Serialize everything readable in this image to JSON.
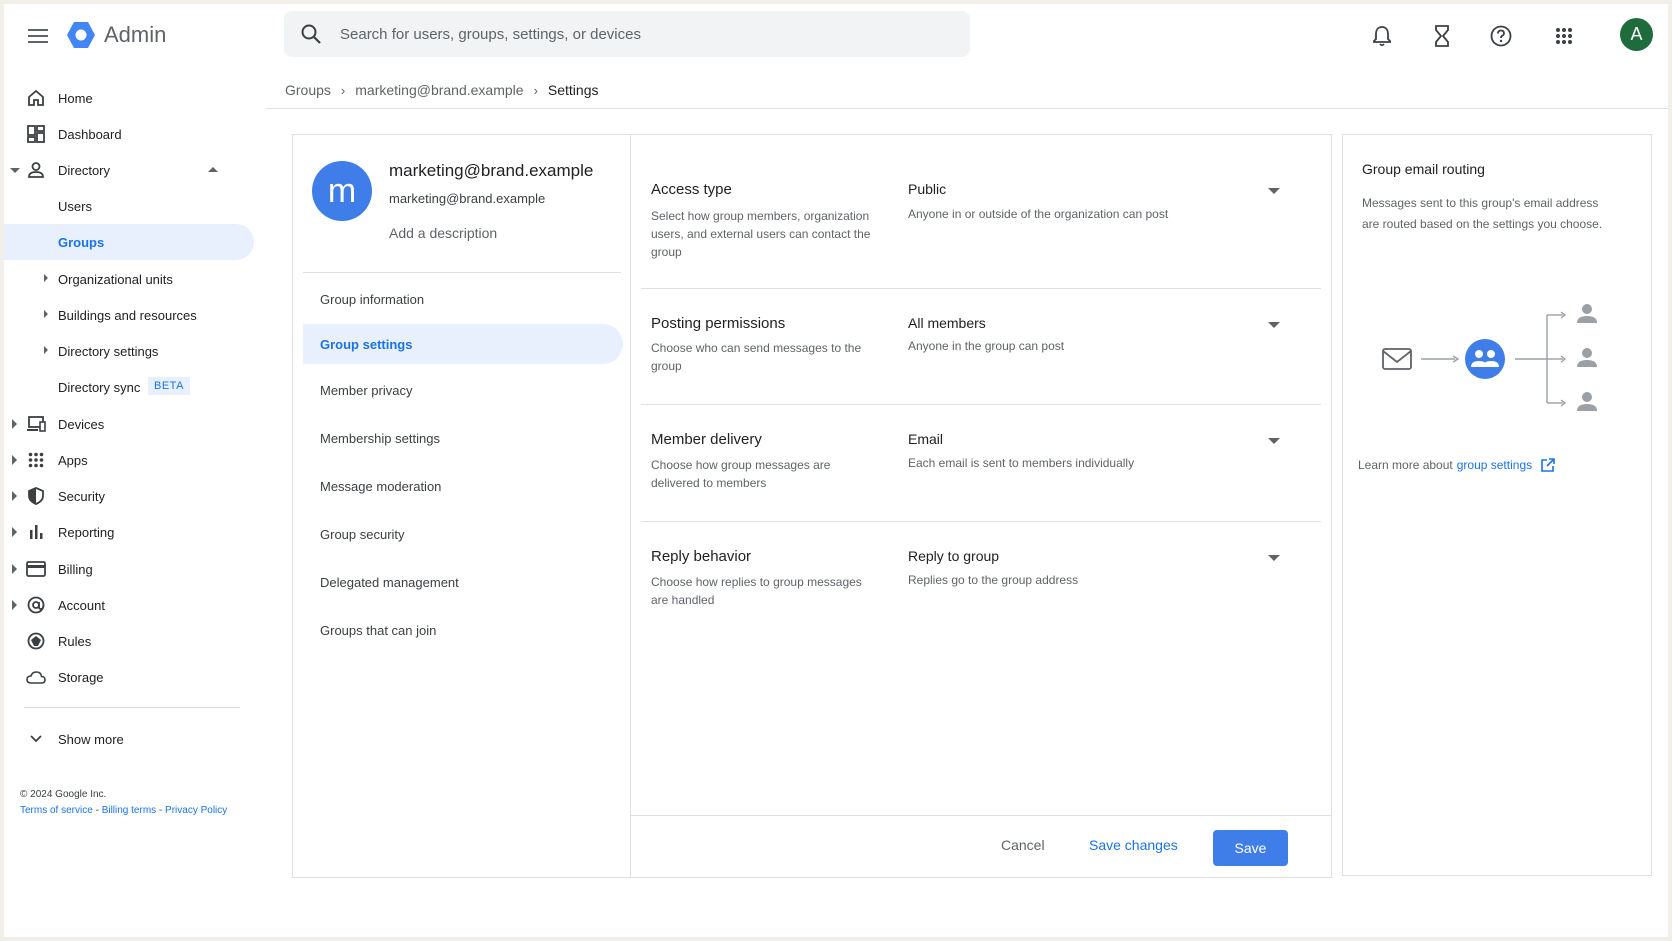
{
  "app": {
    "title": "Admin"
  },
  "search": {
    "placeholder": "Search for users, groups, settings, or devices"
  },
  "user": {
    "initial": "A"
  },
  "sidebar": {
    "items": [
      {
        "label": "Home"
      },
      {
        "label": "Dashboard"
      },
      {
        "label": "Directory"
      },
      {
        "label": "Users"
      },
      {
        "label": "Groups"
      },
      {
        "label": "Organizational units"
      },
      {
        "label": "Buildings and resources"
      },
      {
        "label": "Directory settings"
      },
      {
        "label": "Directory sync"
      },
      {
        "label": "Devices"
      },
      {
        "label": "Apps"
      },
      {
        "label": "Security"
      },
      {
        "label": "Reporting"
      },
      {
        "label": "Billing"
      },
      {
        "label": "Account"
      },
      {
        "label": "Rules"
      },
      {
        "label": "Storage"
      }
    ],
    "beta_badge": "BETA",
    "show_more": "Show more"
  },
  "footer": {
    "copyright": "© 2024 Google Inc.",
    "terms": "Terms of service",
    "billing_terms": "Billing terms",
    "privacy": "Privacy Policy",
    "separator": " - "
  },
  "breadcrumb": {
    "items": [
      "Groups",
      "marketing@brand.example",
      "Settings"
    ]
  },
  "group": {
    "avatar_letter": "m",
    "title": "marketing@brand.example",
    "email": "marketing@brand.example",
    "add_description": "Add a description"
  },
  "group_menu": {
    "items": [
      "Group information",
      "Group settings",
      "Member privacy",
      "Membership settings",
      "Message moderation",
      "Group security",
      "Delegated management",
      "Groups that can join"
    ]
  },
  "settings": [
    {
      "title": "Access type",
      "description": "Select how group members, organization users, and external users can contact the group",
      "value": "Public",
      "help": "Anyone in or outside of the organization can post"
    },
    {
      "title": "Posting permissions",
      "description": "Choose who can send messages to the group",
      "value": "All members",
      "help": "Anyone in the group can post"
    },
    {
      "title": "Member delivery",
      "description": "Choose how group messages are delivered to members",
      "value": "Email",
      "help": "Each email is sent to members individually"
    },
    {
      "title": "Reply behavior",
      "description": "Choose how replies to group messages are handled",
      "value": "Reply to group",
      "help": "Replies go to the group address"
    }
  ],
  "actions": {
    "cancel": "Cancel",
    "save_changes": "Save changes",
    "save": "Save"
  },
  "info": {
    "title": "Group email routing",
    "description": "Messages sent to this group's email address are routed based on the settings you choose.",
    "learn_prefix": "Learn more about",
    "learn_link": "group settings"
  },
  "colors": {
    "accent": "#1a73e8",
    "primary_button": "#3f7ee8",
    "avatar_green": "#1e6b3c"
  }
}
